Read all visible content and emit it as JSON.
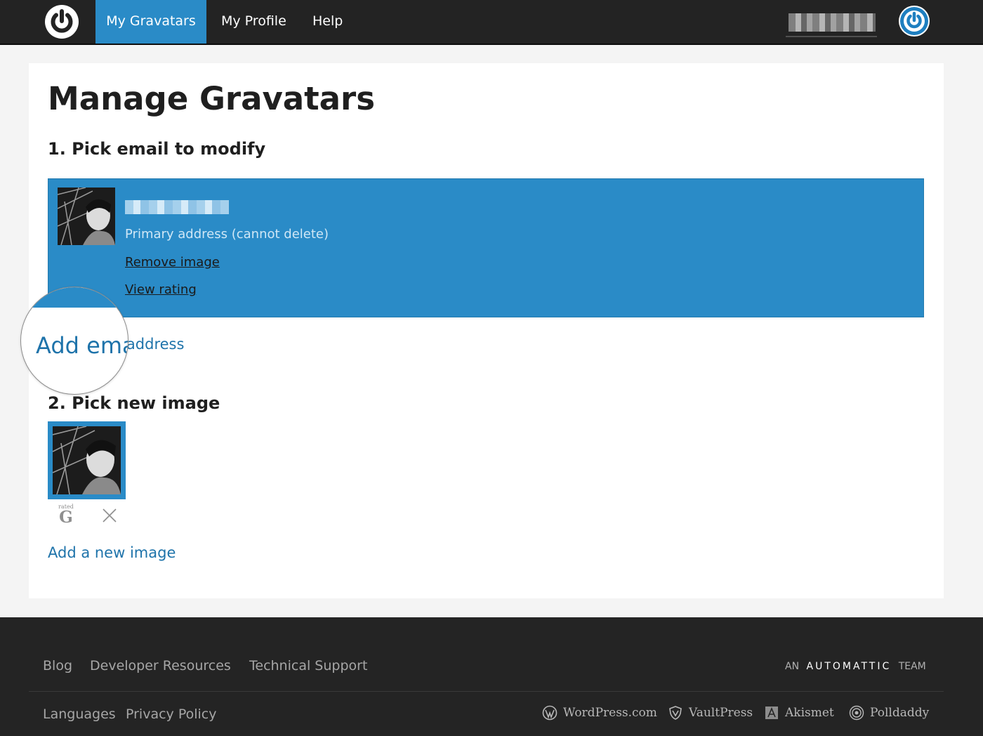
{
  "nav": {
    "tabs": [
      {
        "label": "My Gravatars",
        "active": true
      },
      {
        "label": "My Profile",
        "active": false
      },
      {
        "label": "Help",
        "active": false
      }
    ],
    "accent_color": "#2a8bc7"
  },
  "main": {
    "title": "Manage Gravatars",
    "step1_heading": "1. Pick email to modify",
    "email": {
      "primary_note": "Primary address (cannot delete)",
      "remove_label": "Remove image",
      "rating_label": "View rating"
    },
    "add_email_label": "Add email address",
    "magnifier_text": "Add ema",
    "step2_heading": "2. Pick new image",
    "image_rating": {
      "rated_label": "rated",
      "letter": "G"
    },
    "add_image_label": "Add a new image"
  },
  "footer": {
    "links_row1": [
      "Blog",
      "Developer Resources",
      "Technical Support"
    ],
    "links_row2": [
      "Languages",
      "Privacy Policy"
    ],
    "team_prefix": "AN",
    "team_brand": "AUTOMATTIC",
    "team_suffix": "TEAM",
    "family": [
      "WordPress.com",
      "VaultPress",
      "Akismet",
      "Polldaddy"
    ]
  },
  "icons": {
    "logo": "gravatar-power-icon",
    "user": "user-avatar-icon",
    "delete": "close-x-icon"
  }
}
